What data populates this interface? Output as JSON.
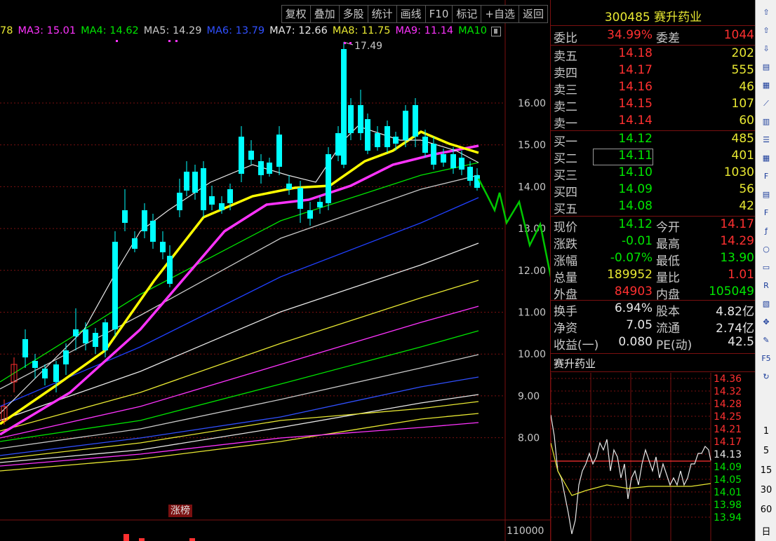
{
  "toolbar": {
    "items": [
      "复权",
      "叠加",
      "多股",
      "统计",
      "画线",
      "F10",
      "标记",
      "+自选",
      "返回"
    ]
  },
  "ma_legend": [
    {
      "label": "78",
      "color": "#e8e832"
    },
    {
      "label": "MA3: 15.01",
      "color": "#ff33ff"
    },
    {
      "label": "MA4: 14.62",
      "color": "#00e600"
    },
    {
      "label": "MA5: 14.29",
      "color": "#c8c8c8"
    },
    {
      "label": "MA6: 13.79",
      "color": "#3050ff"
    },
    {
      "label": "MA7: 12.66",
      "color": "#e8e8e8"
    },
    {
      "label": "MA8: 11.75",
      "color": "#e8e832"
    },
    {
      "label": "MA9: 11.14",
      "color": "#ff33ff"
    },
    {
      "label": "MA10",
      "color": "#00e600"
    }
  ],
  "price_axis": [
    "16.00",
    "15.00",
    "14.00",
    "13.00",
    "12.00",
    "11.00",
    "10.00",
    "9.00",
    "8.00"
  ],
  "volume_axis": "110000",
  "peak_label": "17.49",
  "tag": "涨榜",
  "colors": {
    "up": "#ff3030",
    "down": "#00ffff",
    "ma_yellow": "#ffff00",
    "ma_magenta": "#ff33ff",
    "ma_green": "#00e600",
    "ma_blue": "#2040ff",
    "ma_white": "#c8c8c8",
    "forecast": "#00c800"
  },
  "quote": {
    "title": "300485 赛升药业",
    "weibi_label": "委比",
    "weibi": "34.99%",
    "weicha_label": "委差",
    "weicha": "1044",
    "asks": [
      {
        "label": "卖五",
        "price": "14.18",
        "vol": "202"
      },
      {
        "label": "卖四",
        "price": "14.17",
        "vol": "555"
      },
      {
        "label": "卖三",
        "price": "14.16",
        "vol": "46"
      },
      {
        "label": "卖二",
        "price": "14.15",
        "vol": "107"
      },
      {
        "label": "卖一",
        "price": "14.14",
        "vol": "60"
      }
    ],
    "bids": [
      {
        "label": "买一",
        "price": "14.12",
        "vol": "485"
      },
      {
        "label": "买二",
        "price": "14.11",
        "vol": "401"
      },
      {
        "label": "买三",
        "price": "14.10",
        "vol": "1030"
      },
      {
        "label": "买四",
        "price": "14.09",
        "vol": "56"
      },
      {
        "label": "买五",
        "price": "14.08",
        "vol": "42"
      }
    ],
    "stats": [
      {
        "l1": "现价",
        "v1": "14.12",
        "c1": "green",
        "l2": "今开",
        "v2": "14.17",
        "c2": "red"
      },
      {
        "l1": "涨跌",
        "v1": "-0.01",
        "c1": "green",
        "l2": "最高",
        "v2": "14.29",
        "c2": "red"
      },
      {
        "l1": "涨幅",
        "v1": "-0.07%",
        "c1": "green",
        "l2": "最低",
        "v2": "13.90",
        "c2": "green"
      },
      {
        "l1": "总量",
        "v1": "189952",
        "c1": "yellow",
        "l2": "量比",
        "v2": "1.01",
        "c2": "red"
      },
      {
        "l1": "外盘",
        "v1": "84903",
        "c1": "red",
        "l2": "内盘",
        "v2": "105049",
        "c2": "green"
      }
    ],
    "fin": [
      {
        "l1": "换手",
        "v1": "6.94%",
        "l2": "股本",
        "v2": "4.82亿"
      },
      {
        "l1": "净资",
        "v1": "7.05",
        "l2": "流通",
        "v2": "2.74亿"
      },
      {
        "l1": "收益(一)",
        "v1": "0.080",
        "l2": "PE(动)",
        "v2": "42.5"
      }
    ]
  },
  "mini": {
    "title": "赛升药业",
    "axis": [
      "14.36",
      "14.32",
      "14.28",
      "14.25",
      "14.21",
      "14.17",
      "14.13",
      "14.09",
      "14.05",
      "14.01",
      "13.98",
      "13.94"
    ]
  },
  "sidebar": {
    "icons": [
      "arrow-up-icon",
      "arrow-up-outline-icon",
      "arrow-down-icon",
      "report-icon",
      "grid-icon",
      "trend-icon",
      "kline-icon",
      "list-icon",
      "table-icon",
      "f10-icon",
      "doc-icon",
      "fiz-icon",
      "func-icon",
      "cycle-icon",
      "window-icon",
      "rsi-icon",
      "stats-icon",
      "move-icon",
      "pen-icon",
      "f5-icon",
      "refresh-icon"
    ],
    "nums": [
      "1",
      "5",
      "15",
      "30",
      "60"
    ],
    "bottom": "日"
  }
}
